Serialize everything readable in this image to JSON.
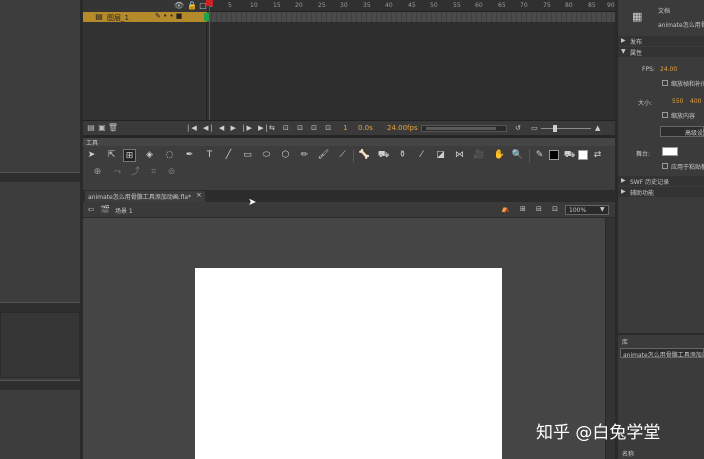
{
  "timeline": {
    "layer_name": "图层_1",
    "frame_numbers": [
      "1",
      "5",
      "10",
      "15",
      "20",
      "25",
      "30",
      "35",
      "40",
      "45",
      "50",
      "55",
      "60",
      "65",
      "70",
      "75",
      "80",
      "85",
      "90"
    ],
    "fps": "24.00",
    "fps_unit": "fps",
    "time": "0.0",
    "time_unit": "s"
  },
  "tools_panel": {
    "title": "工具"
  },
  "document": {
    "tab_label": "animate怎么用骨骼工具添加动画.fla*",
    "scene_label": "场景 1",
    "zoom": "100%"
  },
  "properties": {
    "doc_label": "文档",
    "doc_name": "animate怎么用骨骼",
    "publish_section": "发布",
    "properties_section": "属性",
    "fps_label": "FPS:",
    "fps_value": "24.00",
    "scale_content_label": "缩放帧和补间",
    "size_label": "大小:",
    "width": "550",
    "height": "400",
    "unit": "像素",
    "scale_content2": "缩放内容",
    "adv_button": "高级设置",
    "stage_label": "舞台:",
    "apply_pasteboard": "应用于粘贴板",
    "swf_section": "SWF 历史记录",
    "accessibility_section": "辅助功能"
  },
  "library": {
    "title": "库",
    "file_name": "animate怎么用骨骼工具添加动画.fla",
    "name_column": "名称"
  },
  "watermark": "知乎 @白兔学堂",
  "colors": {
    "accent": "#e8a33d",
    "playhead": "#cc2222",
    "layer_bg": "#b58a2a"
  }
}
